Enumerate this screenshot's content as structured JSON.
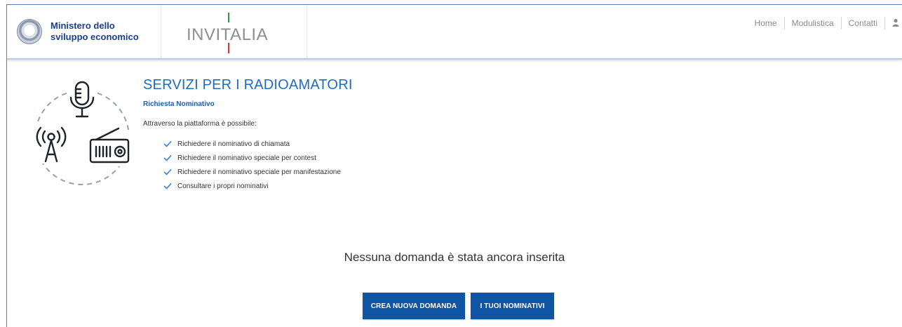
{
  "header": {
    "ministry_line1": "Ministero dello",
    "ministry_line2": "sviluppo economico",
    "brand": "INVITALIA",
    "nav": [
      "Home",
      "Modulistica",
      "Contatti"
    ]
  },
  "main": {
    "title": "SERVIZI PER I RADIOAMATORI",
    "subtitle": "Richiesta Nominativo",
    "intro": "Attraverso la piattaforma è possibile:",
    "features": [
      "Richiedere il nominativo di chiamata",
      "Richiedere il nominativo speciale per contest",
      "Richiedere il nominativo speciale per manifestazione",
      "Consultare i propri nominativi"
    ],
    "empty_message": "Nessuna domanda è stata ancora inserita",
    "buttons": {
      "create": "CREA NUOVA DOMANDA",
      "mine": "I TUOI NOMINATIVI"
    }
  },
  "icons": {
    "check": "checkmark-icon",
    "user": "user-icon",
    "microphone": "microphone-icon",
    "antenna": "antenna-icon",
    "radio": "radio-icon"
  },
  "colors": {
    "primary": "#0f55a3",
    "title_blue": "#1d6cbf",
    "ministry_blue": "#1b3f8b"
  }
}
